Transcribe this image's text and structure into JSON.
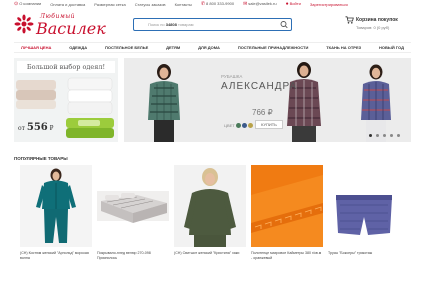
{
  "topbar": {
    "links": [
      {
        "label": "О компании"
      },
      {
        "label": "Оплата и доставка"
      },
      {
        "label": "Размерная сетка"
      },
      {
        "label": "Статусы заказов"
      },
      {
        "label": "Контакты"
      },
      {
        "label": "8 800 333-9900"
      },
      {
        "label": "sale@vasilek.ru"
      }
    ],
    "login": "Войти",
    "register": "Зарегистрироваться"
  },
  "logo": {
    "tagline": "Любимый",
    "name": "Василек"
  },
  "search": {
    "placeholder_prefix": "Поиск по",
    "placeholder_count": "34808",
    "placeholder_suffix": "товарам"
  },
  "cart": {
    "title": "Корзина покупок",
    "summary": "Товаров: 0 (0 руб)"
  },
  "nav": [
    {
      "label": "ЛУЧШАЯ ЦЕНА"
    },
    {
      "label": "ОДЕЖДА"
    },
    {
      "label": "ПОСТЕЛЬНОЕ БЕЛЬЕ"
    },
    {
      "label": "ДЕТЯМ"
    },
    {
      "label": "ДЛЯ ДОМА"
    },
    {
      "label": "ПОСТЕЛЬНЫЕ ПРИНАДЛЕЖНОСТИ"
    },
    {
      "label": "ТКАНЬ НА ОТРЕЗ"
    },
    {
      "label": "НОВЫЙ ГОД"
    }
  ],
  "promo_left": {
    "title": "Большой выбор одеял!",
    "from": "от",
    "price": "556",
    "currency": "₽"
  },
  "banner": {
    "subtitle": "РУБАШКА",
    "title": "АЛЕКСАНДРА",
    "price": "766 ₽",
    "colors_label": "ЦВЕТ",
    "buy_label": "КУПИТЬ",
    "swatch_colors": [
      "#4a7a5a",
      "#3c5a8a",
      "#b8a24a"
    ]
  },
  "section": {
    "title": "ПОПУЛЯРНЫЕ ТОВАРЫ"
  },
  "products": [
    {
      "name": "(CH) Костюм женский \"Арнольд\" морская волна"
    },
    {
      "name": "Покрывало-плед велюр 270-098 Приснилось"
    },
    {
      "name": "(CH) Свитшот женский \"Кристина\" хаки"
    },
    {
      "name": "Полотенце махровое Кайметры 380 г/кв.м - оранжевый"
    },
    {
      "name": "Трусы \"Боксеры\" трикотаж"
    }
  ]
}
